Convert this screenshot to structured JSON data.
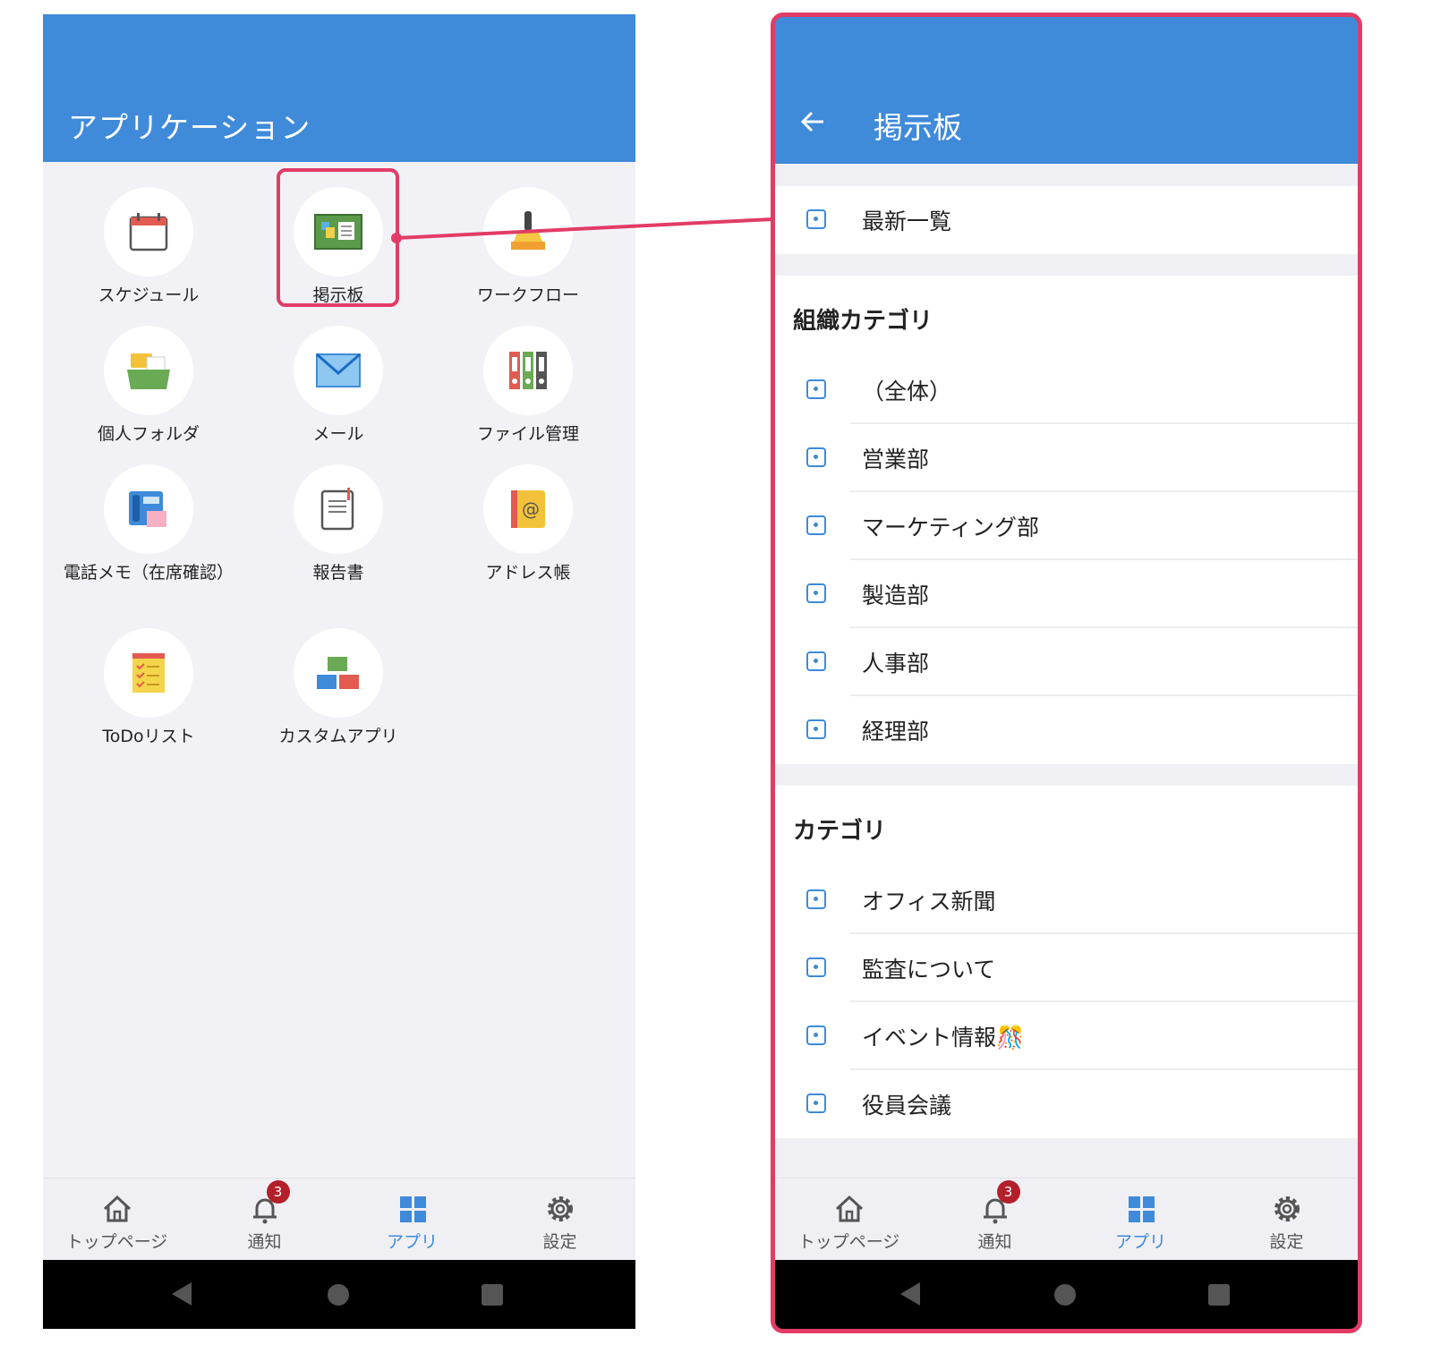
{
  "left_screen": {
    "title": "アプリケーション",
    "apps": [
      {
        "label": "スケジュール",
        "icon": "calendar-icon"
      },
      {
        "label": "掲示板",
        "icon": "bulletin-board-icon"
      },
      {
        "label": "ワークフロー",
        "icon": "stamp-icon"
      },
      {
        "label": "個人フォルダ",
        "icon": "folder-icon"
      },
      {
        "label": "メール",
        "icon": "mail-icon"
      },
      {
        "label": "ファイル管理",
        "icon": "binders-icon"
      },
      {
        "label": "電話メモ（在席確認）",
        "icon": "phone-memo-icon"
      },
      {
        "label": "報告書",
        "icon": "report-icon"
      },
      {
        "label": "アドレス帳",
        "icon": "address-book-icon"
      },
      {
        "label": "ToDoリスト",
        "icon": "todo-list-icon"
      },
      {
        "label": "カスタムアプリ",
        "icon": "blocks-icon"
      }
    ]
  },
  "right_screen": {
    "title": "掲示板",
    "latest": "最新一覧",
    "org_section": {
      "heading": "組織カテゴリ",
      "items": [
        "（全体）",
        "営業部",
        "マーケティング部",
        "製造部",
        "人事部",
        "経理部"
      ]
    },
    "cat_section": {
      "heading": "カテゴリ",
      "items": [
        "オフィス新聞",
        "監査について",
        "イベント情報🎊",
        "役員会議"
      ]
    }
  },
  "bottom_nav": {
    "items": [
      {
        "label": "トップページ",
        "icon": "home-icon"
      },
      {
        "label": "通知",
        "icon": "bell-icon",
        "badge": "3"
      },
      {
        "label": "アプリ",
        "icon": "grid-icon",
        "active": true
      },
      {
        "label": "設定",
        "icon": "gear-icon"
      }
    ]
  },
  "colors": {
    "app_bar": "#3f8ad9",
    "highlight": "#e23c66",
    "badge": "#b3202a"
  }
}
